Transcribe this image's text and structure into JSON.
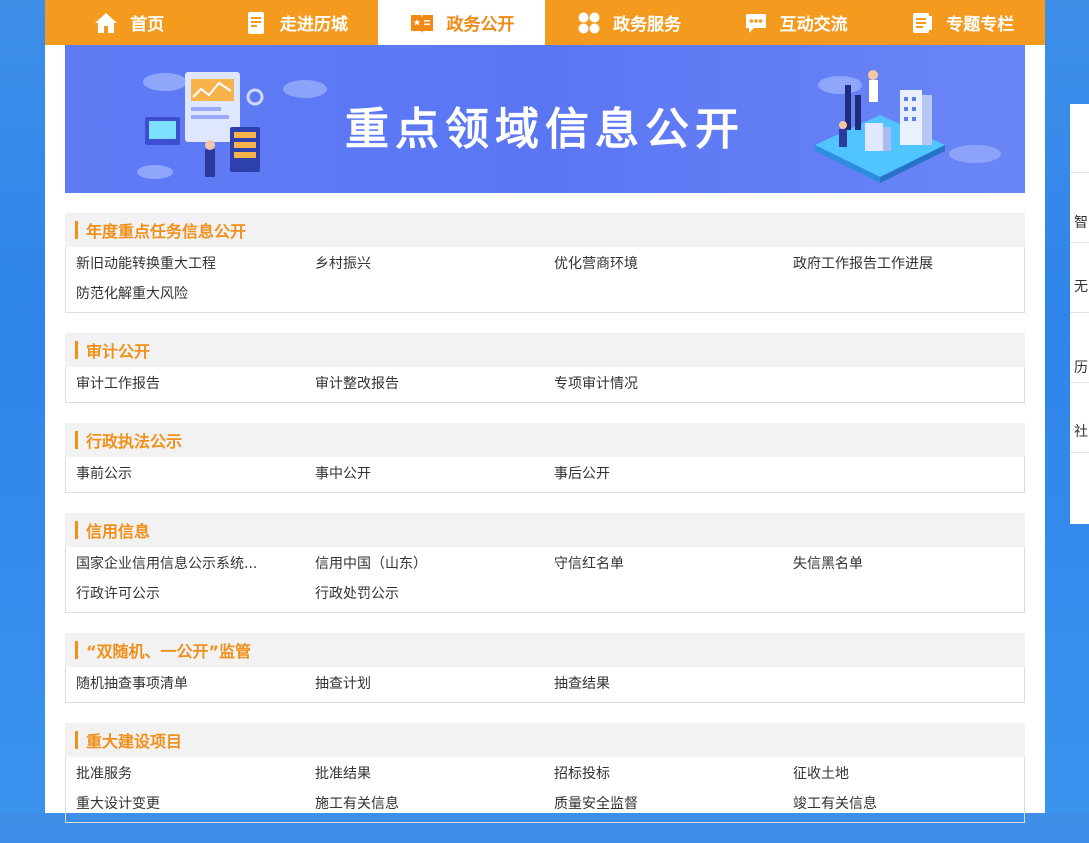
{
  "nav": {
    "items": [
      {
        "label": "首页",
        "icon": "home-icon"
      },
      {
        "label": "走进历城",
        "icon": "document-icon"
      },
      {
        "label": "政务公开",
        "icon": "book-star-icon",
        "active": true
      },
      {
        "label": "政务服务",
        "icon": "grid-circles-icon"
      },
      {
        "label": "互动交流",
        "icon": "chat-bubble-icon"
      },
      {
        "label": "专题专栏",
        "icon": "notes-icon"
      }
    ],
    "accent_color": "#f39a1f"
  },
  "banner": {
    "title": "重点领域信息公开"
  },
  "sections": [
    {
      "title": "年度重点任务信息公开",
      "links": [
        "新旧动能转换重大工程",
        "乡村振兴",
        "优化营商环境",
        "政府工作报告工作进展",
        "防范化解重大风险"
      ]
    },
    {
      "title": "审计公开",
      "links": [
        "审计工作报告",
        "审计整改报告",
        "专项审计情况"
      ]
    },
    {
      "title": "行政执法公示",
      "links": [
        "事前公示",
        "事中公开",
        "事后公开"
      ]
    },
    {
      "title": "信用信息",
      "links": [
        "国家企业信用信息公示系统...",
        "信用中国（山东）",
        "守信红名单",
        "失信黑名单",
        "行政许可公示",
        "行政处罚公示"
      ]
    },
    {
      "title": "“双随机、一公开”监管",
      "links": [
        "随机抽查事项清单",
        "抽查计划",
        "抽查结果"
      ]
    },
    {
      "title": "重大建设项目",
      "links": [
        "批准服务",
        "批准结果",
        "招标投标",
        "征收土地",
        "重大设计变更",
        "施工有关信息",
        "质量安全监督",
        "竣工有关信息"
      ]
    }
  ],
  "side_panel": {
    "chars": [
      "智",
      "无",
      "历",
      "社"
    ]
  }
}
